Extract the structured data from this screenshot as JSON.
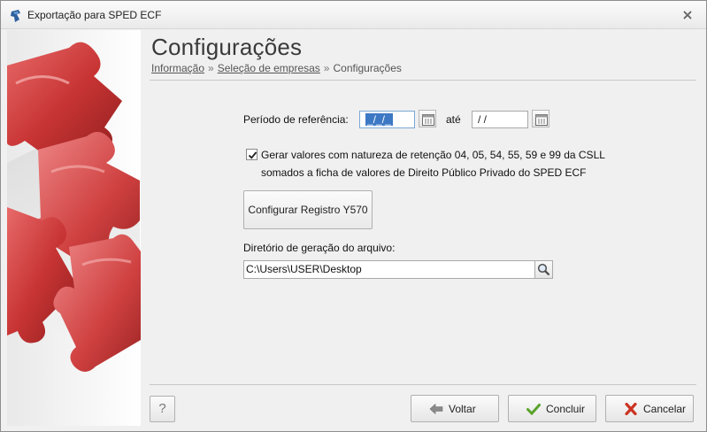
{
  "window": {
    "title": "Exportação para SPED ECF"
  },
  "header": {
    "title": "Configurações",
    "breadcrumb": {
      "item1": "Informação",
      "item2": "Seleção de empresas",
      "item3": "Configurações",
      "separator": "»"
    }
  },
  "form": {
    "period_label": "Período de referência:",
    "date_from": "_/_/_",
    "until_label": "até",
    "date_to": "/ /",
    "checkbox_checked": true,
    "checkbox_line1": "Gerar valores com natureza de retenção 04, 05, 54, 55, 59 e 99 da CSLL",
    "checkbox_line2": "somados a ficha de valores de Direito Público Privado do  SPED ECF",
    "y570_button": "Configurar Registro Y570",
    "dir_label": "Diretório de geração do arquivo:",
    "dir_value": "C:\\Users\\USER\\Desktop"
  },
  "footer": {
    "help": "?",
    "back": "Voltar",
    "finish": "Concluir",
    "cancel": "Cancelar"
  },
  "colors": {
    "accent_red": "#c43a3a",
    "check_green": "#5aa32a",
    "cancel_red": "#cc3322",
    "back_gray": "#8a8a8a"
  },
  "icons": [
    "app-icon",
    "close-icon",
    "calendar-icon",
    "checkmark-icon",
    "search-icon",
    "help-icon",
    "arrow-left-icon",
    "check-icon",
    "x-icon"
  ]
}
